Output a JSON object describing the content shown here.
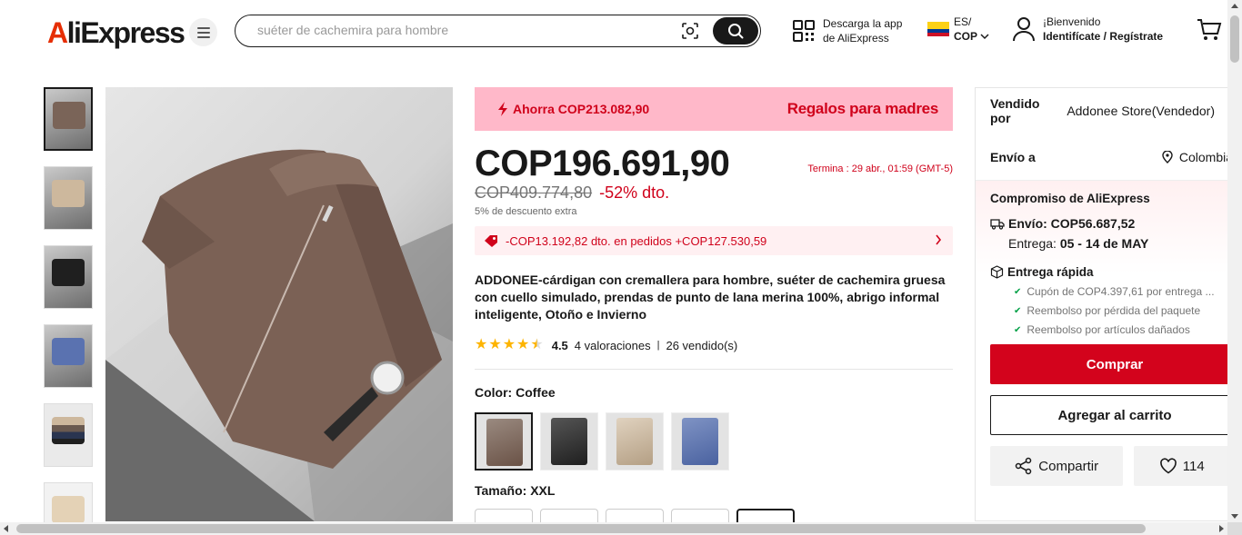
{
  "header": {
    "logo_text": "AliExpress",
    "search_placeholder": "suéter de cachemira para hombre",
    "app_line1": "Descarga la app",
    "app_line2": "de AliExpress",
    "lang": "ES/",
    "currency": "COP",
    "welcome": "¡Bienvenido",
    "signin": "Identifícate / Regístrate"
  },
  "promo": {
    "save_text": "Ahorra COP213.082,90",
    "campaign": "Regalos para madres"
  },
  "product": {
    "price": "COP196.691,90",
    "ends_text": "Termina :  29 abr., 01:59 (GMT-5)",
    "old_price": "COP409.774,80",
    "discount": "-52% dto.",
    "extra_discount": "5% de descuento extra",
    "coupon_text": "-COP13.192,82 dto. en pedidos +COP127.530,59",
    "title": "ADDONEE-cárdigan con cremallera para hombre, suéter de cachemira gruesa con cuello simulado, prendas de punto de lana merina 100%, abrigo informal inteligente, Otoño e Invierno",
    "rating": 4.5,
    "rating_text": "4.5",
    "reviews": "4 valoraciones",
    "sold": "26 vendido(s)",
    "color_label": "Color: ",
    "color_value": "Coffee",
    "size_label": "Tamaño: ",
    "size_value": "XXL"
  },
  "colors": {
    "coffee": "#7a6458",
    "black": "#2a2a2a",
    "beige": "#cdb89d",
    "blue": "#5a72b0",
    "brand_red": "#d3031c"
  },
  "panel": {
    "sold_by_label": "Vendido por",
    "sold_by": "Addonee Store(Vendedor)",
    "ship_to_label": "Envío a",
    "ship_to": "Colombia",
    "commitment": "Compromiso de AliExpress",
    "shipping": "Envío: COP56.687,52",
    "delivery_label": "Entrega: ",
    "delivery_dates": "05 - 14 de MAY",
    "fast_delivery": "Entrega rápida",
    "check1": "Cupón de COP4.397,61 por entrega ...",
    "check2": "Reembolso por pérdida del paquete",
    "check3": "Reembolso por artículos dañados",
    "buy": "Comprar",
    "add_to_cart": "Agregar al carrito",
    "share": "Compartir",
    "wishlist_count": "114"
  }
}
